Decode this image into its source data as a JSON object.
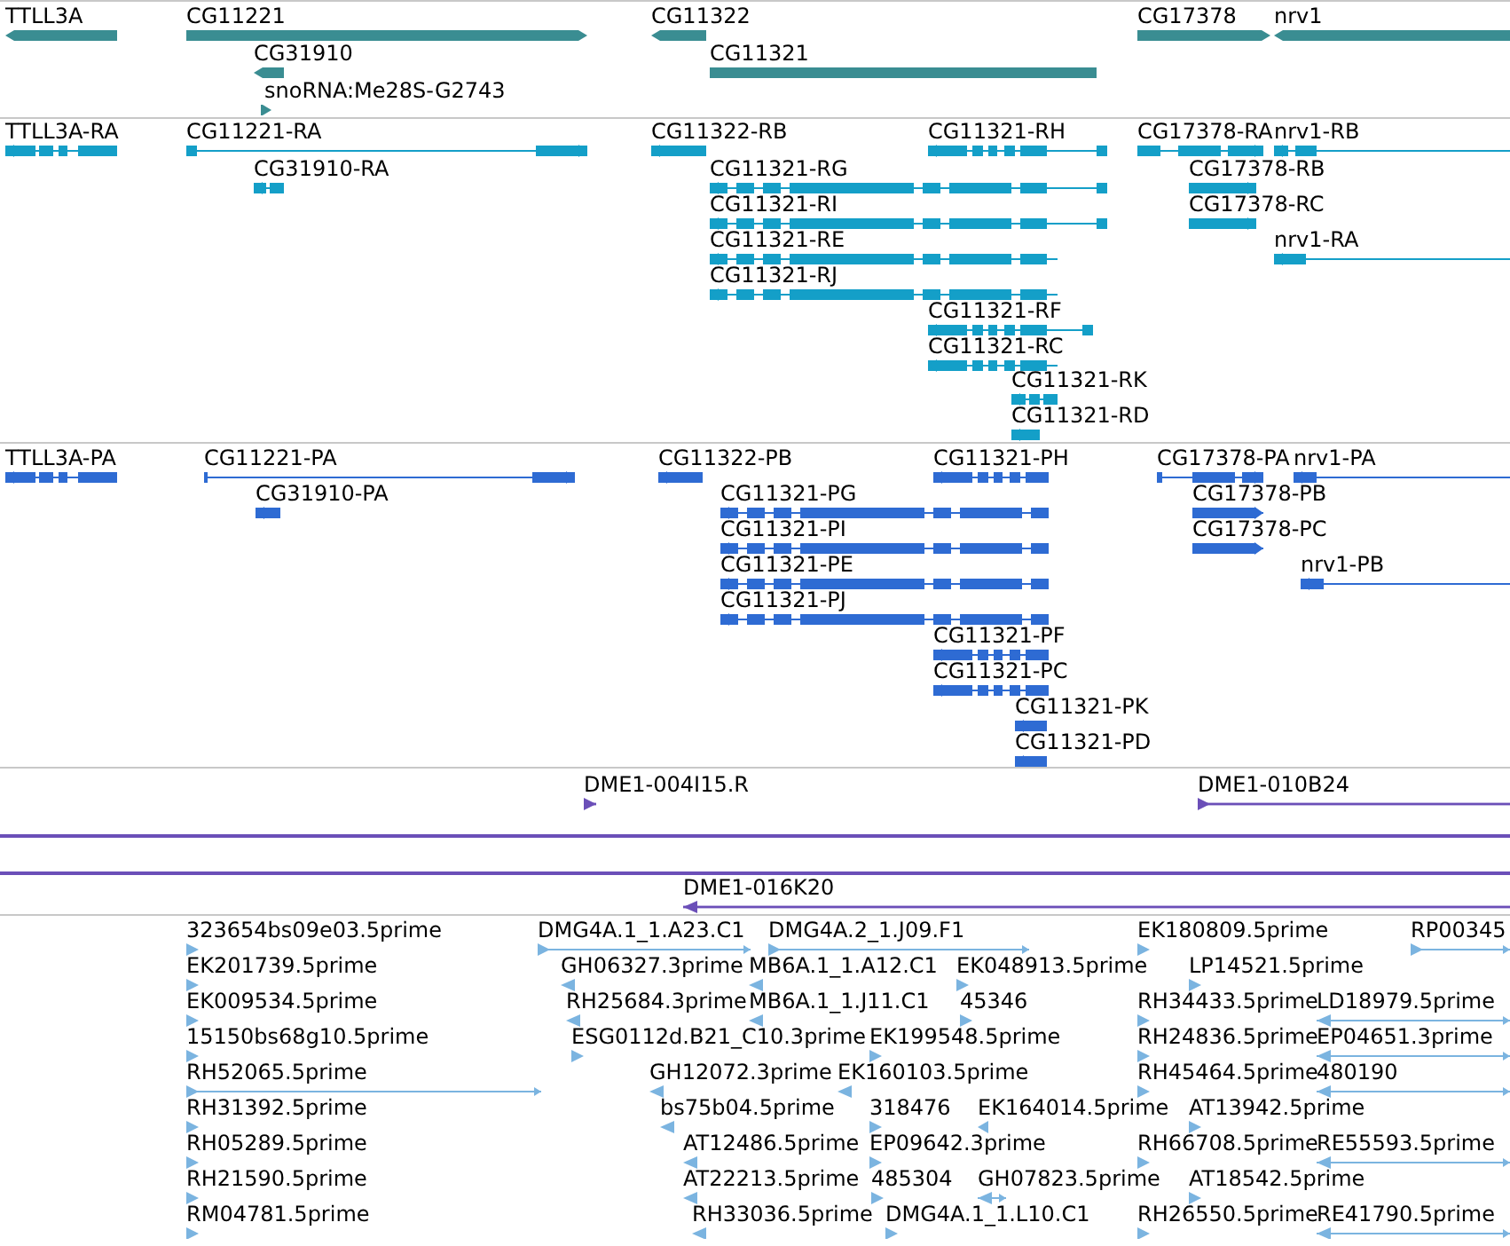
{
  "tracks": [
    {
      "kind": "gene",
      "color": "#3a8d92",
      "features": [
        {
          "label": "TTLL3A"
        },
        {
          "label": "CG11221"
        },
        {
          "label": "CG31910"
        },
        {
          "label": "snoRNA:Me28S-G2743"
        },
        {
          "label": "CG11322"
        },
        {
          "label": "CG11321"
        },
        {
          "label": "CG17378"
        },
        {
          "label": "nrv1"
        }
      ]
    },
    {
      "kind": "transcript",
      "color": "#149fc8",
      "features": [
        {
          "label": "TTLL3A-RA"
        },
        {
          "label": "CG11221-RA"
        },
        {
          "label": "CG31910-RA"
        },
        {
          "label": "CG11322-RB"
        },
        {
          "label": "CG11321-RH"
        },
        {
          "label": "CG11321-RG"
        },
        {
          "label": "CG11321-RI"
        },
        {
          "label": "CG11321-RE"
        },
        {
          "label": "CG11321-RJ"
        },
        {
          "label": "CG11321-RF"
        },
        {
          "label": "CG11321-RC"
        },
        {
          "label": "CG11321-RK"
        },
        {
          "label": "CG11321-RD"
        },
        {
          "label": "CG17378-RA"
        },
        {
          "label": "nrv1-RB"
        },
        {
          "label": "CG17378-RB"
        },
        {
          "label": "CG17378-RC"
        },
        {
          "label": "nrv1-RA"
        }
      ]
    },
    {
      "kind": "transcript",
      "color": "#2e6bd3",
      "features": [
        {
          "label": "TTLL3A-PA"
        },
        {
          "label": "CG11221-PA"
        },
        {
          "label": "CG31910-PA"
        },
        {
          "label": "CG11322-PB"
        },
        {
          "label": "CG11321-PH"
        },
        {
          "label": "CG11321-PG"
        },
        {
          "label": "CG11321-PI"
        },
        {
          "label": "CG11321-PE"
        },
        {
          "label": "CG11321-PJ"
        },
        {
          "label": "CG11321-PF"
        },
        {
          "label": "CG11321-PC"
        },
        {
          "label": "CG11321-PK"
        },
        {
          "label": "CG11321-PD"
        },
        {
          "label": "CG17378-PA"
        },
        {
          "label": "nrv1-PA"
        },
        {
          "label": "CG17378-PB"
        },
        {
          "label": "CG17378-PC"
        },
        {
          "label": "nrv1-PB"
        }
      ]
    },
    {
      "kind": "clone",
      "color": "#6b4fb8",
      "features": [
        {
          "label": "DME1-004I15.R"
        },
        {
          "label": "DME1-010B24"
        },
        {
          "label": "DME1-016K20"
        }
      ]
    },
    {
      "kind": "read",
      "color": "#7bb4e0",
      "features": [
        {
          "label": "323654bs09e03.5prime"
        },
        {
          "label": "DMG4A.1_1.A23.C1"
        },
        {
          "label": "DMG4A.2_1.J09.F1"
        },
        {
          "label": "EK180809.5prime"
        },
        {
          "label": "RP00345"
        },
        {
          "label": "EK201739.5prime"
        },
        {
          "label": "GH06327.3prime"
        },
        {
          "label": "MB6A.1_1.A12.C1"
        },
        {
          "label": "EK048913.5prime"
        },
        {
          "label": "LP14521.5prime"
        },
        {
          "label": "EK009534.5prime"
        },
        {
          "label": "RH25684.3prime"
        },
        {
          "label": "MB6A.1_1.J11.C1"
        },
        {
          "label": "45346"
        },
        {
          "label": "RH34433.5prime"
        },
        {
          "label": "LD18979.5prime"
        },
        {
          "label": "15150bs68g10.5prime"
        },
        {
          "label": "ESG0112d.B21_C10.3prime"
        },
        {
          "label": "EK199548.5prime"
        },
        {
          "label": "RH24836.5prime"
        },
        {
          "label": "EP04651.3prime"
        },
        {
          "label": "RH52065.5prime"
        },
        {
          "label": "GH12072.3prime"
        },
        {
          "label": "EK160103.5prime"
        },
        {
          "label": "RH45464.5prime"
        },
        {
          "label": "480190"
        },
        {
          "label": "RH31392.5prime"
        },
        {
          "label": "bs75b04.5prime"
        },
        {
          "label": "318476"
        },
        {
          "label": "EK164014.5prime"
        },
        {
          "label": "AT13942.5prime"
        },
        {
          "label": "RH05289.5prime"
        },
        {
          "label": "AT12486.5prime"
        },
        {
          "label": "EP09642.3prime"
        },
        {
          "label": "RH66708.5prime"
        },
        {
          "label": "RE55593.5prime"
        },
        {
          "label": "RH21590.5prime"
        },
        {
          "label": "AT22213.5prime"
        },
        {
          "label": "485304"
        },
        {
          "label": "GH07823.5prime"
        },
        {
          "label": "AT18542.5prime"
        },
        {
          "label": "RM04781.5prime"
        },
        {
          "label": "RH33036.5prime"
        },
        {
          "label": "DMG4A.1_1.L10.C1"
        },
        {
          "label": "RH26550.5prime"
        },
        {
          "label": "RE41790.5prime"
        }
      ]
    }
  ]
}
